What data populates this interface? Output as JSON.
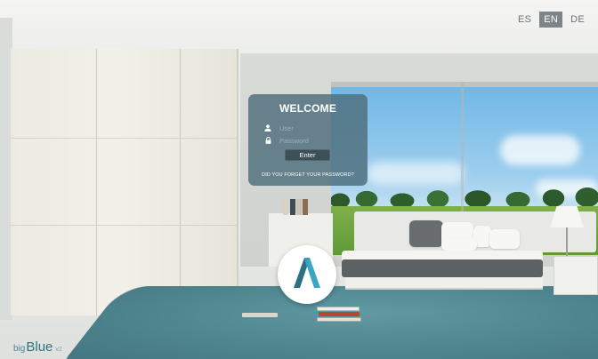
{
  "languages": [
    {
      "code": "ES",
      "active": false
    },
    {
      "code": "EN",
      "active": true
    },
    {
      "code": "DE",
      "active": false
    }
  ],
  "login": {
    "title": "WELCOME",
    "user_placeholder": "User",
    "password_placeholder": "Password",
    "enter_label": "Enter",
    "forgot_label": "DID YOU FORGET YOUR PASSWORD?"
  },
  "brand": {
    "prefix": "big",
    "name": "Blue",
    "version": "v2"
  },
  "colors": {
    "panel": "#4d6e7b",
    "logo_teal": "#39a6c6",
    "logo_dark": "#2a6f86",
    "brand": "#2f7486"
  },
  "icons": {
    "user": "user-icon",
    "password": "lock-icon",
    "logo": "a-logo-icon"
  }
}
